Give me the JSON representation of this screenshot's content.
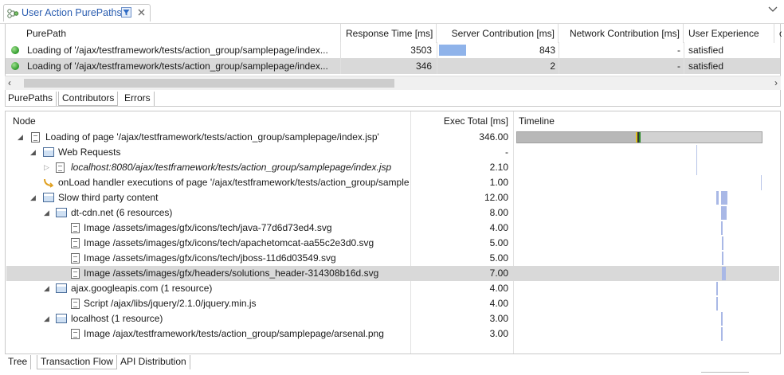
{
  "view": {
    "title": "User Action PurePaths"
  },
  "top_table": {
    "columns": [
      "PurePath",
      "Response Time [ms]",
      "Server Contribution [ms]",
      "Network Contribution [ms]",
      "User Experience"
    ],
    "rows": [
      {
        "purepath": "Loading of '/ajax/testframework/tests/action_group/samplepage/index...",
        "response_time": "3503",
        "server_contribution": "843",
        "server_bar_fraction": 0.3,
        "network_contribution": "-",
        "user_experience": "satisfied"
      },
      {
        "purepath": "Loading of '/ajax/testframework/tests/action_group/samplepage/index...",
        "response_time": "346",
        "server_contribution": "2",
        "server_bar_fraction": 0.0,
        "network_contribution": "-",
        "user_experience": "satisfied"
      }
    ],
    "tabs": [
      "PurePaths",
      "Contributors",
      "Errors"
    ]
  },
  "tree": {
    "columns": [
      "Node",
      "Exec Total [ms]",
      "Timeline"
    ],
    "rows": [
      {
        "label": "Loading of page '/ajax/testframework/tests/action_group/samplepage/index.jsp'",
        "exec": "346.00",
        "icon": "page-icon"
      },
      {
        "label": "Web Requests",
        "exec": "-",
        "icon": "group-icon"
      },
      {
        "label": "localhost:8080/ajax/testframework/tests/action_group/samplepage/index.jsp",
        "exec": "2.10",
        "icon": "page-icon"
      },
      {
        "label": "onLoad handler executions of page '/ajax/testframework/tests/action_group/sample",
        "exec": "1.00",
        "icon": "handler-icon"
      },
      {
        "label": "Slow third party content",
        "exec": "12.00",
        "icon": "group-icon"
      },
      {
        "label": "dt-cdn.net (6 resources)",
        "exec": "8.00",
        "icon": "group-icon"
      },
      {
        "label": "Image /assets/images/gfx/icons/tech/java-77d6d73ed4.svg",
        "exec": "4.00",
        "icon": "page-icon"
      },
      {
        "label": "Image /assets/images/gfx/icons/tech/apachetomcat-aa55c2e3d0.svg",
        "exec": "5.00",
        "icon": "page-icon"
      },
      {
        "label": "Image /assets/images/gfx/icons/tech/jboss-11d6d03549.svg",
        "exec": "5.00",
        "icon": "page-icon"
      },
      {
        "label": "Image /assets/images/gfx/headers/solutions_header-314308b16d.svg",
        "exec": "7.00",
        "icon": "page-icon"
      },
      {
        "label": "ajax.googleapis.com (1 resource)",
        "exec": "4.00",
        "icon": "group-icon"
      },
      {
        "label": "Script /ajax/libs/jquery/2.1.0/jquery.min.js",
        "exec": "4.00",
        "icon": "page-icon"
      },
      {
        "label": "localhost (1 resource)",
        "exec": "3.00",
        "icon": "group-icon"
      },
      {
        "label": "Image /ajax/testframework/tests/action_group/samplepage/arsenal.png",
        "exec": "3.00",
        "icon": "page-icon"
      }
    ],
    "tabs": [
      "Tree",
      "Transaction Flow",
      "API Distribution"
    ]
  },
  "colors": {
    "title_blue": "#2a5db0",
    "bar_blue": "#a9b8e6",
    "selection_gray": "#d9d9d9",
    "status_green": "#2e9a2a"
  }
}
